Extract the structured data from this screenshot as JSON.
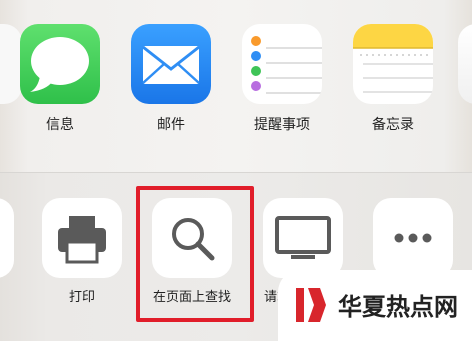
{
  "share_sheet": {
    "apps": [
      {
        "label": "信息",
        "icon": "messages-icon"
      },
      {
        "label": "邮件",
        "icon": "mail-icon"
      },
      {
        "label": "提醒事项",
        "icon": "reminders-icon"
      },
      {
        "label": "备忘录",
        "icon": "notes-icon"
      }
    ],
    "actions": [
      {
        "label": "打印",
        "icon": "printer-icon"
      },
      {
        "label": "在页面上查找",
        "icon": "search-icon"
      },
      {
        "label": "请求桌面网站",
        "icon": "monitor-icon"
      },
      {
        "label": "",
        "icon": "more-icon"
      }
    ]
  },
  "colors": {
    "messages_green": "#35c84b",
    "mail_blue": "#2f8ef4",
    "notes_yellow": "#fdd644",
    "highlight_red": "#e11d2a",
    "watermark_red": "#d8262c"
  },
  "watermark": {
    "text": "华夏热点网",
    "icon": "logo-mark"
  }
}
